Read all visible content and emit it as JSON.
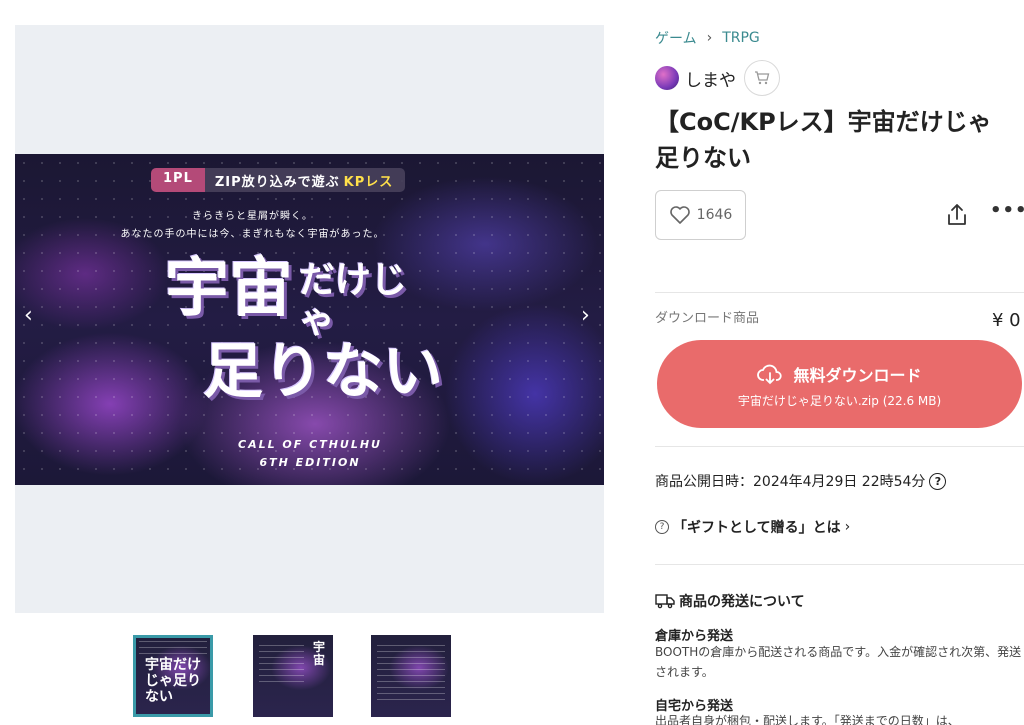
{
  "breadcrumb": {
    "category": "ゲーム",
    "subcategory": "TRPG"
  },
  "shop": {
    "name": "しまや"
  },
  "product": {
    "title": "【CoC/KPレス】宇宙だけじゃ足りない",
    "likes": "1646"
  },
  "banner": {
    "tag_1pl": "1PL",
    "tag_zip": "ZIP放り込みで遊ぶ",
    "tag_kp": "KPレス",
    "subtitle_1": "きらきらと星屑が瞬く。",
    "subtitle_2": "あなたの手の中には今、まぎれもなく宇宙があった。",
    "title_a": "宇宙",
    "title_b": "だけじゃ",
    "title_c": "足りない",
    "system_1": "CALL OF CTHULHU",
    "system_2": "6TH EDITION"
  },
  "thumbnails": [
    {
      "label": "宇宙だけじゃ足りない",
      "active": true
    },
    {
      "label": "宇宙",
      "active": false
    },
    {
      "label": "",
      "active": false
    }
  ],
  "purchase": {
    "type_label": "ダウンロード商品",
    "price": "¥ 0",
    "button_label": "無料ダウンロード",
    "file_label": "宇宙だけじゃ足りない.zip (22.6 MB)"
  },
  "info": {
    "published_label": "商品公開日時：2024年4月29日 22時54分",
    "gift_label": "「ギフトとして贈る」とは"
  },
  "shipping": {
    "title": "商品の発送について",
    "warehouse_title": "倉庫から発送",
    "warehouse_text": "BOOTHの倉庫から配送される商品です。入金が確認され次第、発送されます。",
    "home_title": "自宅から発送",
    "home_text": "出品者自身が梱包・配送します。「発送までの日数」は、"
  },
  "colors": {
    "accent": "#3a8a8f",
    "download_button": "#e96b6b"
  },
  "icons": [
    "chevron-right-icon",
    "cart-icon",
    "heart-icon",
    "share-icon",
    "more-icon",
    "cloud-download-icon",
    "help-icon",
    "truck-icon",
    "chevron-left-icon"
  ]
}
